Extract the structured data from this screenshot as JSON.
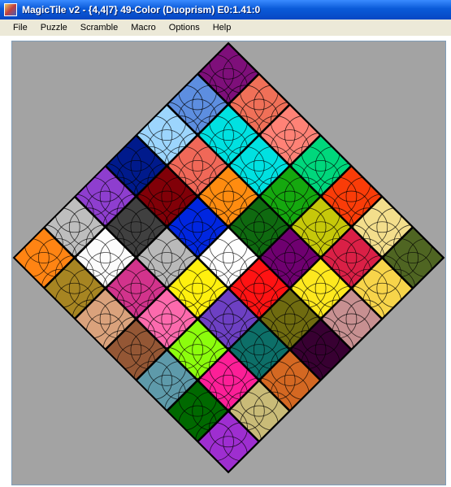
{
  "window": {
    "title": "MagicTile v2 - {4,4|7} 49-Color (Duoprism) E0:1.41:0"
  },
  "menu": {
    "items": [
      "File",
      "Puzzle",
      "Scramble",
      "Macro",
      "Options",
      "Help"
    ]
  },
  "puzzle": {
    "background_color": "#a3a3a3",
    "grid_line_color": "#000000",
    "rows": [
      [
        "#7e0f7a",
        "#f07058",
        "#ff8276",
        "#00d77c",
        "#fa3c08",
        "#f3de8c",
        "#4f6522"
      ],
      [
        "#5d8ee0",
        "#00e1e1",
        "#00e1e1",
        "#15a80f",
        "#c6c80a",
        "#da2046",
        "#f7d44a"
      ],
      [
        "#9cd5fd",
        "#f06858",
        "#ff8c10",
        "#0f6a10",
        "#6f0070",
        "#fee81f",
        "#c79091"
      ],
      [
        "#001a8c",
        "#810008",
        "#0026e0",
        "#fefefe",
        "#ff1313",
        "#6f6b10",
        "#380032"
      ],
      [
        "#8e3ecf",
        "#404040",
        "#b9b9b9",
        "#fff00e",
        "#6d40c3",
        "#0d6f68",
        "#d46822"
      ],
      [
        "#bebebe",
        "#fcfcfc",
        "#d2338c",
        "#fc6aad",
        "#8cfd0d",
        "#fc1f97",
        "#c9bb78"
      ],
      [
        "#ff8413",
        "#a78522",
        "#daa27c",
        "#945735",
        "#5e9aaa",
        "#006900",
        "#9e2ed0"
      ]
    ]
  }
}
